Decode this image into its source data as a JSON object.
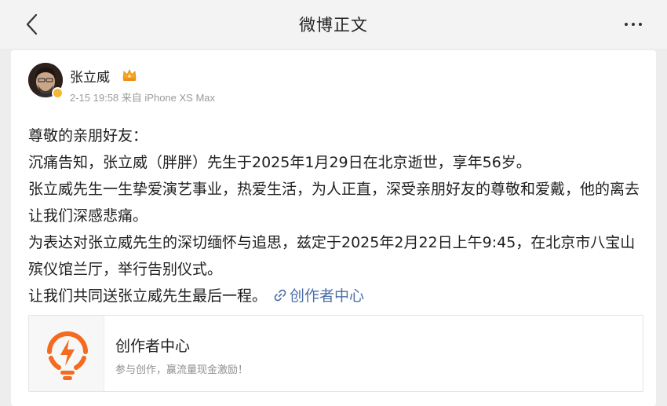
{
  "header": {
    "title": "微博正文",
    "back_icon": "chevron-left-icon",
    "more_icon": "more-dots-icon"
  },
  "post": {
    "author": "张立威",
    "timestamp": "2-15 19:58",
    "source": "来自 iPhone XS Max",
    "paragraphs": [
      "尊敬的亲朋好友：",
      "沉痛告知，张立威（胖胖）先生于2025年1月29日在北京逝世，享年56岁。",
      "张立威先生一生挚爱演艺事业，热爱生活，为人正直，深受亲朋好友的尊敬和爱戴，他的离去让我们深感悲痛。",
      "为表达对张立威先生的深切缅怀与追思，兹定于2025年2月22日上午9:45，在北京市八宝山殡仪馆兰厅，举行告别仪式。",
      "让我们共同送张立威先生最后一程。"
    ],
    "link_label": "创作者中心",
    "link_color": "#4a6ea8"
  },
  "link_card": {
    "title": "创作者中心",
    "subtitle": "参与创作，赢流量现金激励！",
    "accent": "#f26b21"
  }
}
